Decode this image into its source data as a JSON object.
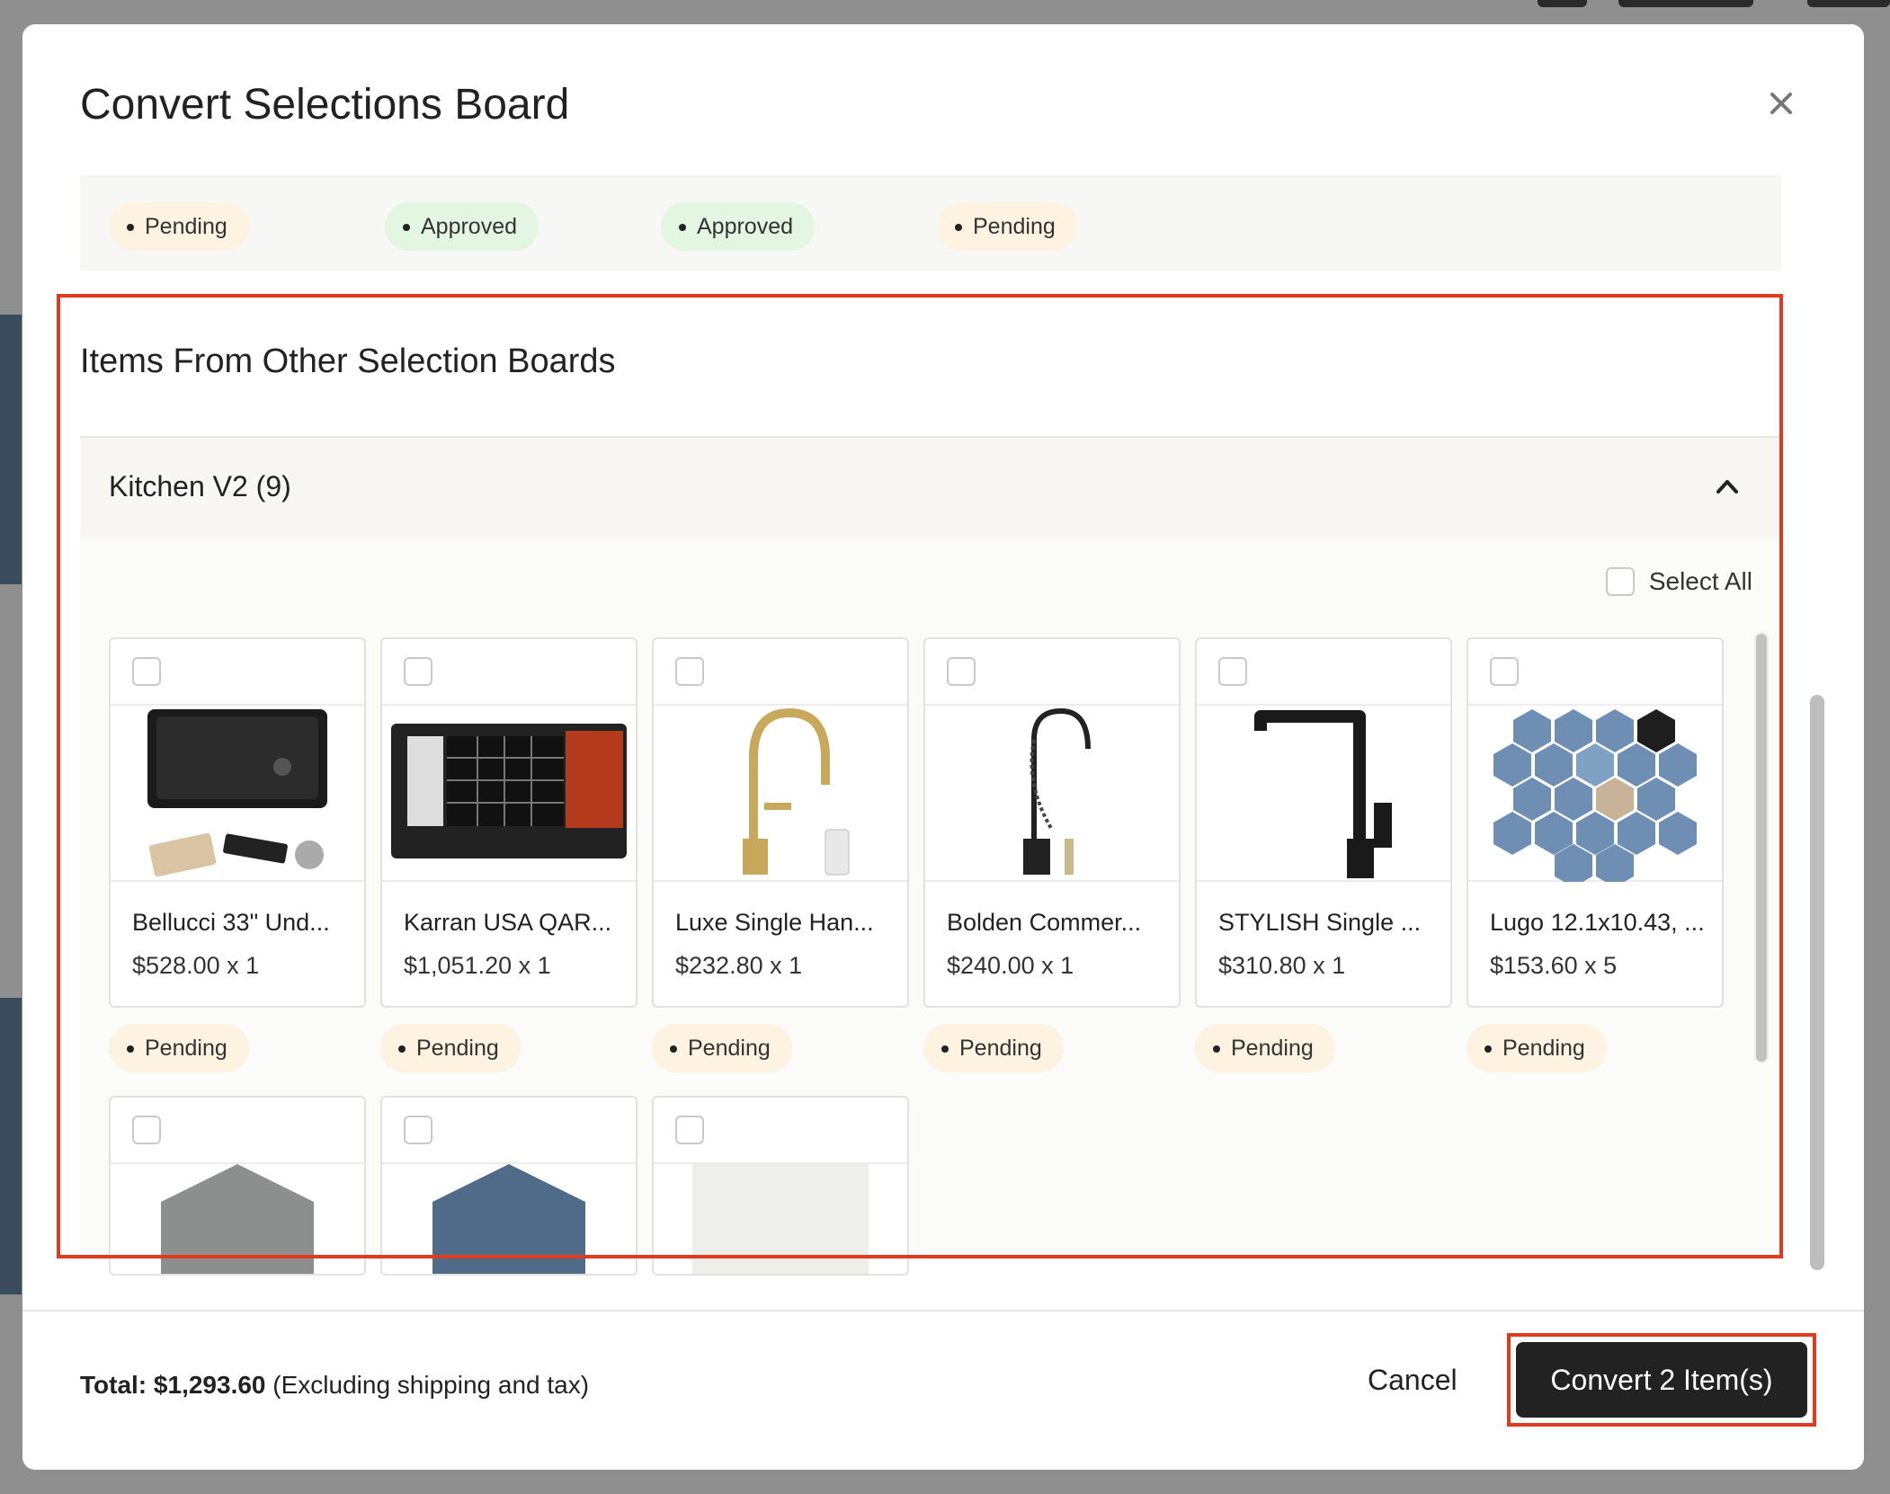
{
  "modal": {
    "title": "Convert Selections Board",
    "close_icon": "close-icon"
  },
  "previous_section": {
    "statuses": [
      "Pending",
      "Approved",
      "Approved",
      "Pending"
    ]
  },
  "other_boards": {
    "heading": "Items From Other Selection Boards",
    "group": {
      "title": "Kitchen V2 (9)",
      "select_all_label": "Select All",
      "items": [
        {
          "name": "Bellucci 33\" Und...",
          "price": "$528.00 x 1",
          "status": "Pending",
          "image": "black-undermount-sink"
        },
        {
          "name": "Karran USA QAR...",
          "price": "$1,051.20 x 1",
          "status": "Pending",
          "image": "workstation-sink"
        },
        {
          "name": "Luxe Single Han...",
          "price": "$232.80 x 1",
          "status": "Pending",
          "image": "gold-faucet"
        },
        {
          "name": "Bolden Commer...",
          "price": "$240.00 x 1",
          "status": "Pending",
          "image": "commercial-faucet"
        },
        {
          "name": "STYLISH Single ...",
          "price": "$310.80 x 1",
          "status": "Pending",
          "image": "black-faucet"
        },
        {
          "name": "Lugo 12.1x10.43, ...",
          "price": "$153.60 x 5",
          "status": "Pending",
          "image": "blue-hex-tile"
        },
        {
          "name": "",
          "price": "",
          "status": "",
          "image": "gray-hex-tile"
        },
        {
          "name": "",
          "price": "",
          "status": "",
          "image": "blue-hex-tile-single"
        },
        {
          "name": "",
          "price": "",
          "status": "",
          "image": "white-tile"
        }
      ]
    }
  },
  "footer": {
    "total_label": "Total:",
    "total_value": "$1,293.60",
    "total_note": "(Excluding shipping and tax)",
    "cancel_label": "Cancel",
    "convert_label": "Convert 2 Item(s)"
  },
  "colors": {
    "pending_bg": "#fdf3e0",
    "approved_bg": "#e3f6e1",
    "highlight": "#e23a1f",
    "primary_button": "#222222"
  }
}
